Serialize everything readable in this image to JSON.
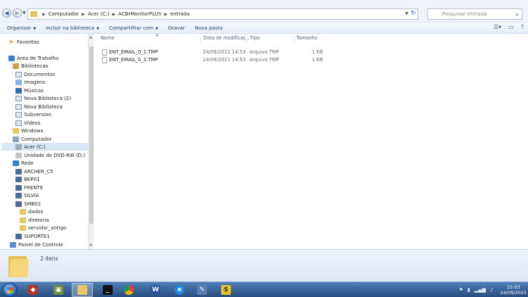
{
  "address": {
    "crumbs": [
      "Computador",
      "Acer (C:)",
      "ACBrMonitorPLUS",
      "entrada"
    ]
  },
  "search": {
    "placeholder": "Pesquisar entrada"
  },
  "toolbar": {
    "organize": "Organizar",
    "include": "Incluir na biblioteca",
    "share": "Compartilhar com",
    "burn": "Gravar",
    "new_folder": "Nova pasta"
  },
  "nav": {
    "favorites": "Favoritos",
    "desktop": "Área de Trabalho",
    "libraries": "Bibliotecas",
    "documents": "Documentos",
    "images": "Imagens",
    "music": "Músicas",
    "new_library_2": "Nova Biblioteca (2)",
    "new_library": "Nova Biblioteca",
    "subversion": "Subversion",
    "videos": "Vídeos",
    "windows": "Windows",
    "computer": "Computador",
    "acer_c": "Acer (C:)",
    "dvd": "Unidade de DVD-RW (D:)",
    "network": "Rede",
    "archer": "ARCHER_C5",
    "bkp01": "BKP01",
    "frente": "FRENTE",
    "silvia": "SILVIA",
    "smb01": "SMB01",
    "dados": "dados",
    "diretoria": "diretoria",
    "servidor_antigo": "servidor_antigo",
    "suporte1": "SUPORTE1",
    "control_panel": "Painel de Controle"
  },
  "columns": {
    "name": "Nome",
    "modified": "Data de modificaç...",
    "type": "Tipo",
    "size": "Tamanho"
  },
  "files": [
    {
      "name": "ENT_EMAIL_0_1.TMP",
      "modified": "24/09/2021 14:53",
      "type": "Arquivo TMP",
      "size": "1 KB"
    },
    {
      "name": "ENT_EMAIL_0_2.TMP",
      "modified": "24/09/2021 14:53",
      "type": "Arquivo TMP",
      "size": "1 KB"
    }
  ],
  "details": {
    "count": "2 itens"
  },
  "taskbar": {
    "time": "15:03",
    "date": "24/09/2021"
  },
  "colors": {
    "accent": "#3b6fb5",
    "taskbar": "#284d7f",
    "folder": "#e8c764"
  }
}
